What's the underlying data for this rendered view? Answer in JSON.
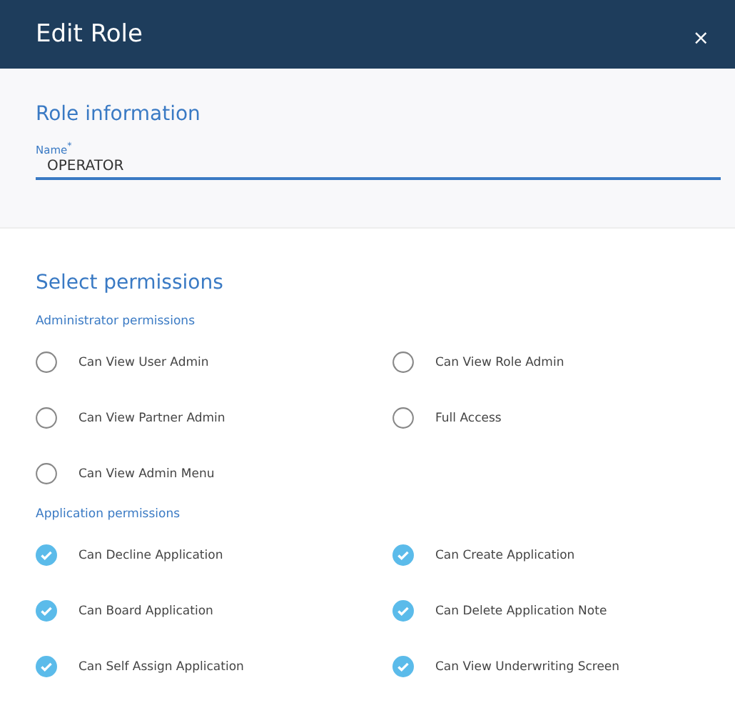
{
  "window": {
    "title": "Edit Role",
    "close": "×"
  },
  "role_information": {
    "heading": "Role information",
    "name_field": {
      "label": "Name$^{*}$",
      "value": "OPERATOR"
    }
  },
  "permissions": {
    "heading": "Select permissions",
    "groups": [
      {
        "title": "Administrator permissions",
        "items": [
          {
            "label": "Can View User Admin",
            "checked": false
          },
          {
            "label": "Can View Role Admin",
            "checked": false
          },
          {
            "label": "Can View Partner Admin",
            "checked": false
          },
          {
            "label": "Full Access",
            "checked": false
          },
          {
            "label": "Can View Admin Menu",
            "checked": false
          }
        ]
      },
      {
        "title": "Application permissions",
        "items": [
          {
            "label": "Can Decline Application",
            "checked": true
          },
          {
            "label": "Can Create Application",
            "checked": true
          },
          {
            "label": "Can Board Application",
            "checked": true
          },
          {
            "label": "Can Delete Application Note",
            "checked": true
          },
          {
            "label": "Can Self Assign Application",
            "checked": true
          },
          {
            "label": "Can View Underwriting Screen",
            "checked": true
          }
        ]
      }
    ]
  }
}
